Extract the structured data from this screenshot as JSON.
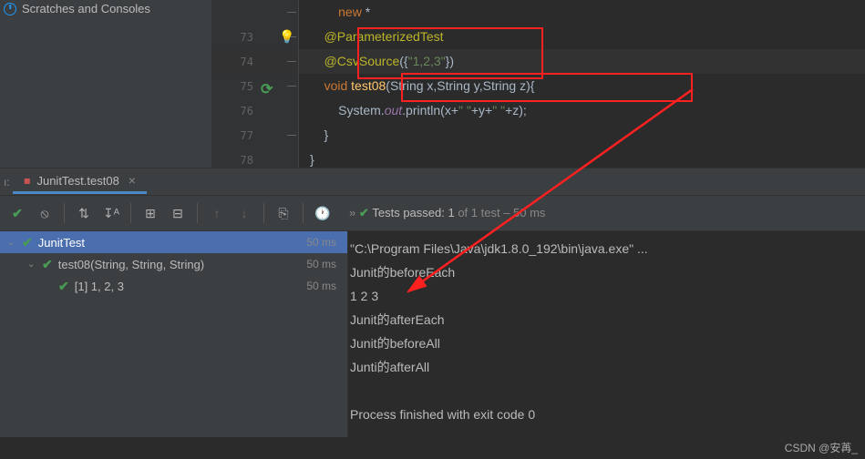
{
  "project": {
    "item": "Scratches and Consoles"
  },
  "gutter": {
    "lines": [
      "73",
      "74",
      "75",
      "76",
      "77",
      "78"
    ]
  },
  "code": {
    "l0_prefix": "        ",
    "l0_new": "new",
    "l0_star": " *",
    "l1_prefix": "    ",
    "l1_anno": "@ParameterizedTest",
    "l2_prefix": "    ",
    "l2_anno": "@CsvSource",
    "l2_paren": "({",
    "l2_str": "\"1,2,3\"",
    "l2_close": "})",
    "l3_prefix": "    ",
    "l3_void": "void ",
    "l3_method": "test08",
    "l3_params": "(String x,String y,String z){",
    "l4_prefix": "        System.",
    "l4_out": "out",
    "l4_print": ".println(x+",
    "l4_s1": "\" \"",
    "l4_mid": "+y+",
    "l4_s2": "\" \"",
    "l4_end": "+z);",
    "l5": "    }",
    "l6": "}"
  },
  "tab": {
    "label": "JunitTest.test08",
    "close": "×"
  },
  "toolbar": {
    "status_prefix": "» ",
    "status_pass": "Tests passed:",
    "status_count": " 1 ",
    "status_of": "of 1 test",
    "status_time": " – 50 ms"
  },
  "tree": {
    "root": "JunitTest",
    "root_time": "50 ms",
    "node1": "test08(String, String, String)",
    "node1_time": "50 ms",
    "leaf": "[1] 1, 2, 3",
    "leaf_time": "50 ms"
  },
  "output": {
    "l0": "\"C:\\Program Files\\Java\\jdk1.8.0_192\\bin\\java.exe\" ...",
    "l1": "Junit的beforeEach",
    "l2": "1 2 3",
    "l3": "Junit的afterEach",
    "l4": "Junit的beforeAll",
    "l5": "Junti的afterAll",
    "l6": "",
    "l7": "Process finished with exit code 0"
  },
  "watermark": "CSDN @安苒_"
}
